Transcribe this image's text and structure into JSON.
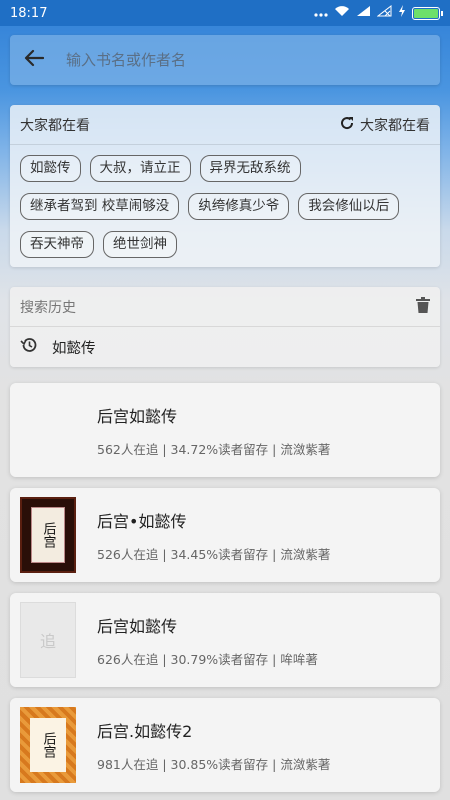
{
  "status_bar": {
    "time": "18:17",
    "icons": [
      "more-dots-icon",
      "wifi-icon",
      "signal-icon",
      "signal-off-icon",
      "charging-icon",
      "battery-icon"
    ]
  },
  "search": {
    "placeholder": "输入书名或作者名"
  },
  "hot": {
    "title": "大家都在看",
    "refresh_label": "大家都在看",
    "tags": [
      "如懿传",
      "大叔，请立正",
      "异界无敌系统",
      "继承者驾到 校草闹够没",
      "纨绔修真少爷",
      "我会修仙以后",
      "吞天神帝",
      "绝世剑神"
    ]
  },
  "history": {
    "title": "搜索历史",
    "items": [
      "如懿传"
    ]
  },
  "books": [
    {
      "title": "后宫如懿传",
      "meta": "562人在追 | 34.72%读者留存 | 流潋紫著",
      "cover": "none"
    },
    {
      "title": "后宫•如懿传",
      "meta": "526人在追 | 34.45%读者留存 | 流潋紫著",
      "cover": "dark-red",
      "cover_text": "后宫"
    },
    {
      "title": "后宫如懿传",
      "meta": "626人在追 | 30.79%读者留存 | 哞哞著",
      "cover": "placeholder",
      "cover_text": "追"
    },
    {
      "title": "后宫.如懿传2",
      "meta": "981人在追 | 30.85%读者留存 | 流潋紫著",
      "cover": "orange",
      "cover_text": "后宫"
    }
  ]
}
